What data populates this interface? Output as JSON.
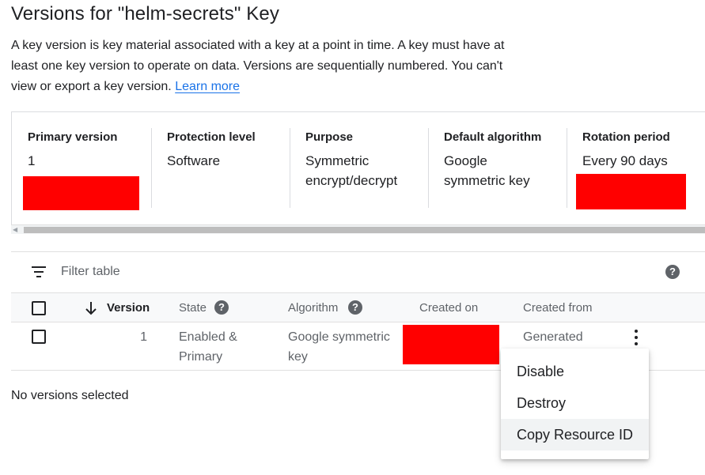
{
  "page": {
    "title": "Versions for \"helm-secrets\" Key",
    "description": "A key version is key material associated with a key at a point in time. A key must have at least one key version to operate on data. Versions are sequentially numbered. You can't view or export a key version.",
    "learn_more": "Learn more"
  },
  "summary": {
    "primary_version": {
      "label": "Primary version",
      "value": "1"
    },
    "protection_level": {
      "label": "Protection level",
      "value": "Software"
    },
    "purpose": {
      "label": "Purpose",
      "value": "Symmetric encrypt/decrypt"
    },
    "default_algorithm": {
      "label": "Default algorithm",
      "value": "Google symmetric key"
    },
    "rotation_period": {
      "label": "Rotation period",
      "value": "Every 90 days"
    }
  },
  "table": {
    "filter_placeholder": "Filter table",
    "columns": {
      "version": "Version",
      "state": "State",
      "algorithm": "Algorithm",
      "created_on": "Created on",
      "created_from": "Created from"
    },
    "rows": [
      {
        "version": "1",
        "state": "Enabled & Primary",
        "algorithm": "Google symmetric key",
        "created_on": "",
        "created_from": "Generated"
      }
    ],
    "selection_status": "No versions selected"
  },
  "menu": {
    "items": [
      "Disable",
      "Destroy",
      "Copy Resource ID"
    ]
  },
  "colors": {
    "link": "#1a73e8",
    "redaction": "#ff0000",
    "header_bg": "#f8f9fa",
    "menu_hover": "#f1f3f4"
  },
  "icons": {
    "filter": "filter-lines-icon",
    "help": "help-circle-icon",
    "sort": "arrow-down-icon",
    "more": "more-vert-icon"
  }
}
